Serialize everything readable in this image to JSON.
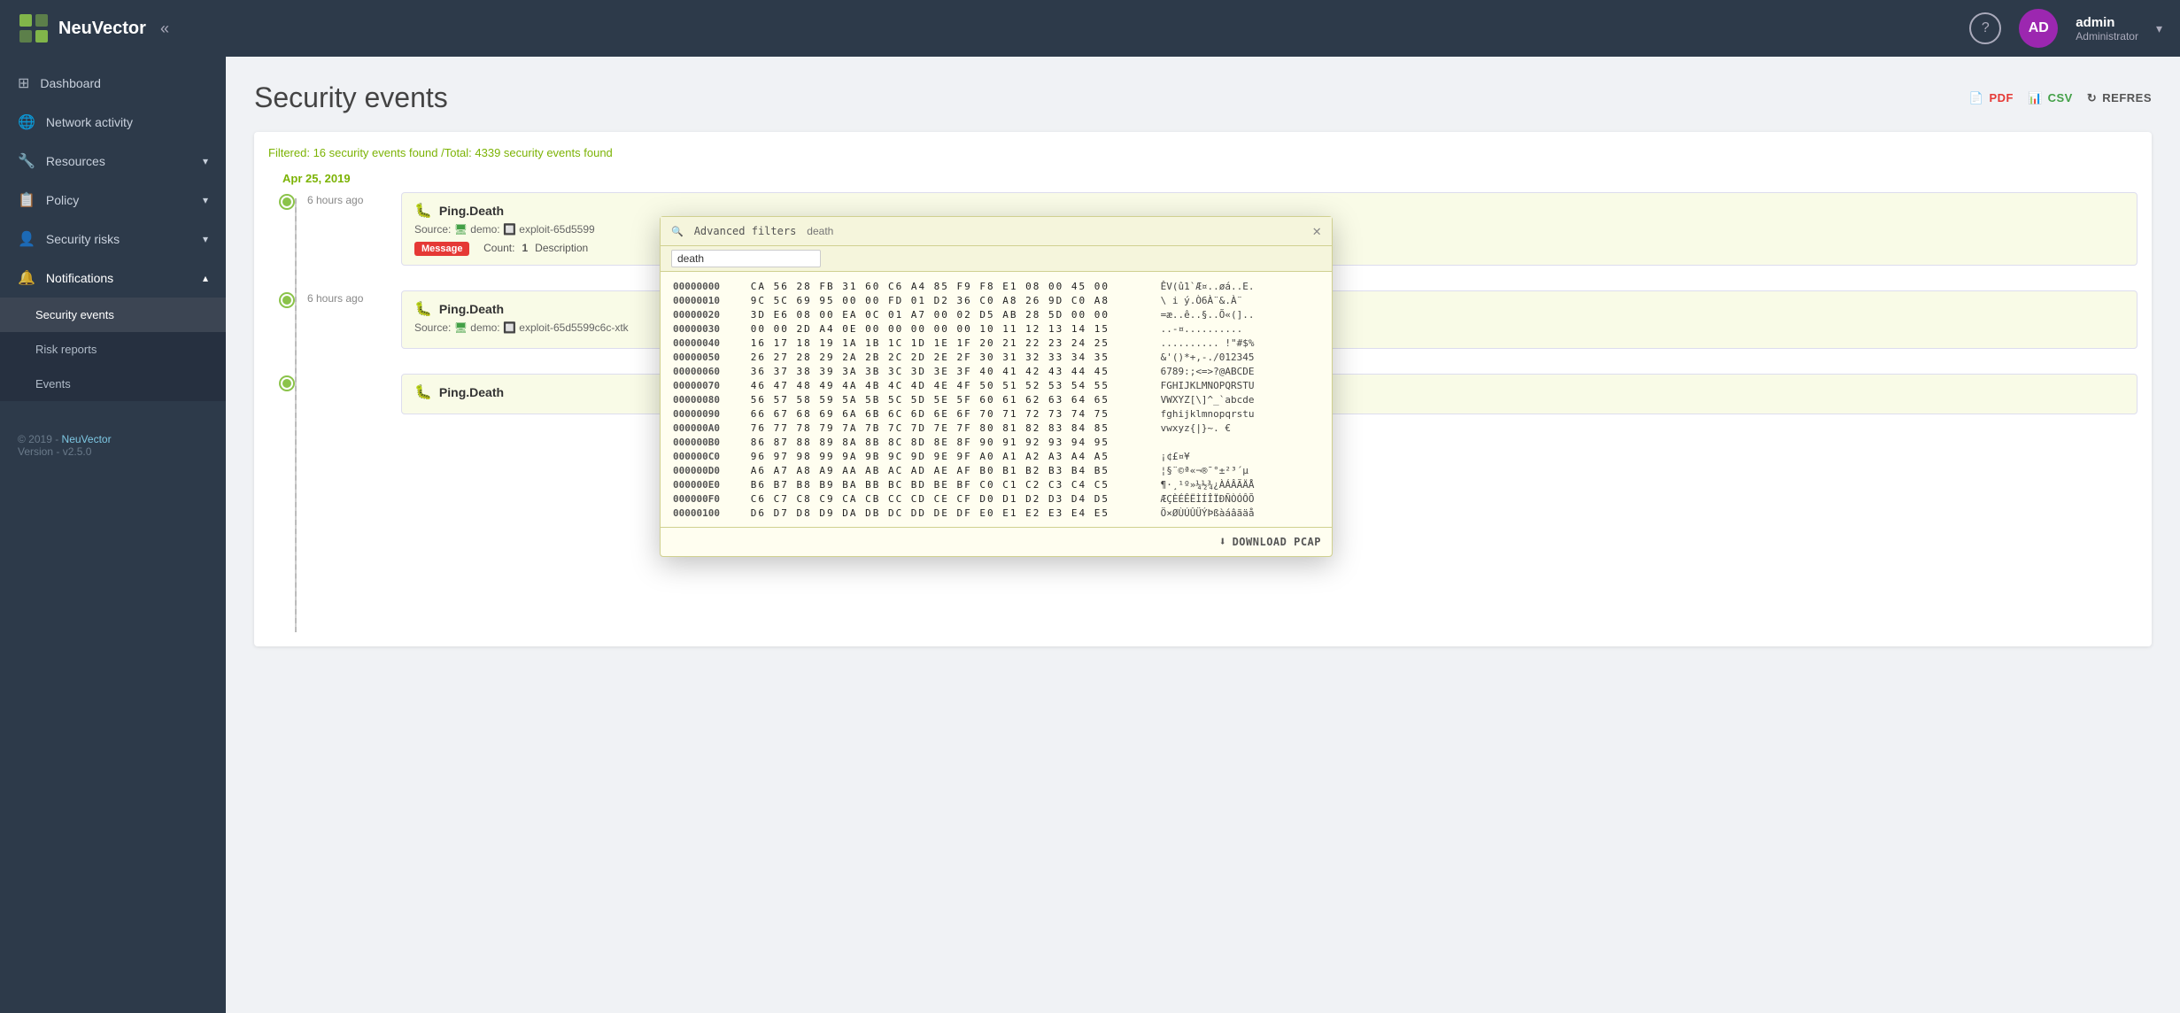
{
  "topbar": {
    "logo_text": "NeuVector",
    "collapse_icon": "«",
    "help_icon": "?",
    "avatar_initials": "AD",
    "user_name": "admin",
    "user_role": "Administrator",
    "chevron": "▾"
  },
  "sidebar": {
    "items": [
      {
        "id": "dashboard",
        "label": "Dashboard",
        "icon": "⊞",
        "has_sub": false
      },
      {
        "id": "network-activity",
        "label": "Network activity",
        "icon": "🌐",
        "has_sub": false
      },
      {
        "id": "resources",
        "label": "Resources",
        "icon": "🔧",
        "has_sub": true
      },
      {
        "id": "policy",
        "label": "Policy",
        "icon": "📋",
        "has_sub": true
      },
      {
        "id": "security-risks",
        "label": "Security risks",
        "icon": "👤",
        "has_sub": true
      },
      {
        "id": "notifications",
        "label": "Notifications",
        "icon": "🔔",
        "has_sub": true,
        "expanded": true
      }
    ],
    "sub_items": [
      {
        "id": "security-events",
        "label": "Security events",
        "active": true
      },
      {
        "id": "risk-reports",
        "label": "Risk reports",
        "active": false
      },
      {
        "id": "events",
        "label": "Events",
        "active": false
      }
    ],
    "footer_copyright": "© 2019 - ",
    "footer_link": "NeuVector",
    "footer_version": "Version - v2.5.0"
  },
  "page": {
    "title": "Security events",
    "toolbar": {
      "pdf_label": "PDF",
      "csv_label": "CSV",
      "refresh_label": "REFRES"
    },
    "filter_text": "Filtered: 16 security events found /Total: 4339 security events found",
    "timeline_date": "Apr 25, 2019"
  },
  "events": [
    {
      "time": "6 hours ago",
      "title": "Ping.Death",
      "source_label": "Source:",
      "source_container": "demo:",
      "source_detail": "exploit-65d5599",
      "msg_btn": "Message",
      "count_label": "Count:",
      "count_val": "1",
      "desc_label": "Description"
    },
    {
      "time": "6 hours ago",
      "title": "Ping.Death",
      "source_label": "Source:",
      "source_container": "demo:",
      "source_detail": "exploit-65d5599c6c-xtk",
      "msg_btn": "",
      "count_label": "",
      "count_val": "",
      "desc_label": ""
    },
    {
      "time": "",
      "title": "Ping.Death",
      "source_label": "",
      "source_container": "",
      "source_detail": "",
      "msg_btn": "",
      "count_label": "",
      "count_val": "",
      "desc_label": ""
    }
  ],
  "hex_popup": {
    "adv_filter_label": "Advanced filters",
    "search_placeholder": "death",
    "close_icon": "✕",
    "title_input_value": "death",
    "download_btn": "DOWNLOAD PCAP",
    "rows": [
      {
        "addr": "00000000",
        "highlight": "CA",
        "bytes": "56 28 FB 31 60 C6 A4 85 F9 F8 E1 08 00 45 00",
        "ascii": "ÊV(û1`Æ¤..øá..E."
      },
      {
        "addr": "00000010",
        "highlight": "",
        "bytes": "9C 5C 69 95 00 00 FD 01 D2 36 C0 A8 26 9D C0 A8",
        "ascii": "\\ i ý.Ò6À¨&.À¨"
      },
      {
        "addr": "00000020",
        "highlight": "",
        "bytes": "3D E6 08 00 EA 0C 01 A7 00 02 D5 AB 28 5D 00 00",
        "ascii": "=æ..ê..§..Õ«(].."
      },
      {
        "addr": "00000030",
        "highlight": "",
        "bytes": "00 00 2D A4 0E 00 00 00 00 00 10 11 12 13 14 15",
        "ascii": "..-¤.........."
      },
      {
        "addr": "00000040",
        "highlight": "",
        "bytes": "16 17 18 19 1A 1B 1C 1D 1E 1F 20 21 22 23 24 25",
        "ascii": ".......... !\"#$%"
      },
      {
        "addr": "00000050",
        "highlight": "",
        "bytes": "26 27 28 29 2A 2B 2C 2D 2E 2F 30 31 32 33 34 35",
        "ascii": "&'()*+,-./012345"
      },
      {
        "addr": "00000060",
        "highlight": "",
        "bytes": "36 37 38 39 3A 3B 3C 3D 3E 3F 40 41 42 43 44 45",
        "ascii": "6789:;<=>?@ABCDE"
      },
      {
        "addr": "00000070",
        "highlight": "",
        "bytes": "46 47 48 49 4A 4B 4C 4D 4E 4F 50 51 52 53 54 55",
        "ascii": "FGHIJKLMNOPQRSTU"
      },
      {
        "addr": "00000080",
        "highlight": "",
        "bytes": "56 57 58 59 5A 5B 5C 5D 5E 5F 60 61 62 63 64 65",
        "ascii": "VWXYZ[\\]^_`abcde"
      },
      {
        "addr": "00000090",
        "highlight": "",
        "bytes": "66 67 68 69 6A 6B 6C 6D 6E 6F 70 71 72 73 74 75",
        "ascii": "fghijklmnopqrstu"
      },
      {
        "addr": "000000A0",
        "highlight": "",
        "bytes": "76 77 78 79 7A 7B 7C 7D 7E 7F 80 81 82 83 84 85",
        "ascii": "vwxyz{|}~. € "
      },
      {
        "addr": "000000B0",
        "highlight": "",
        "bytes": "86 87 88 89 8A 8B 8C 8D 8E 8F 90 91 92 93 94 95",
        "ascii": ""
      },
      {
        "addr": "000000C0",
        "highlight": "",
        "bytes": "96 97 98 99 9A 9B 9C 9D 9E 9F A0 A1 A2 A3 A4 A5",
        "ascii": "  ¡¢£¤¥"
      },
      {
        "addr": "000000D0",
        "highlight": "",
        "bytes": "A6 A7 A8 A9 AA AB AC AD AE AF B0 B1 B2 B3 B4 B5",
        "ascii": "¦§¨©ª«¬­®¯°±²³´µ"
      },
      {
        "addr": "000000E0",
        "highlight": "",
        "bytes": "B6 B7 B8 B9 BA BB BC BD BE BF C0 C1 C2 C3 C4 C5",
        "ascii": "¶·¸¹º»¼½¾¿ÀÁÂÃÄÅ"
      },
      {
        "addr": "000000F0",
        "highlight": "",
        "bytes": "C6 C7 C8 C9 CA CB CC CD CE CF D0 D1 D2 D3 D4 D5",
        "ascii": "ÆÇÈÉÊËÌÍÎÏÐÑÒÓÔÕ"
      },
      {
        "addr": "00000100",
        "highlight": "",
        "bytes": "D6 D7 D8 D9 DA DB DC DD DE DF E0 E1 E2 E3 E4 E5",
        "ascii": "Ö×ØÙÚÛÜÝÞßàáâãäå"
      }
    ]
  }
}
